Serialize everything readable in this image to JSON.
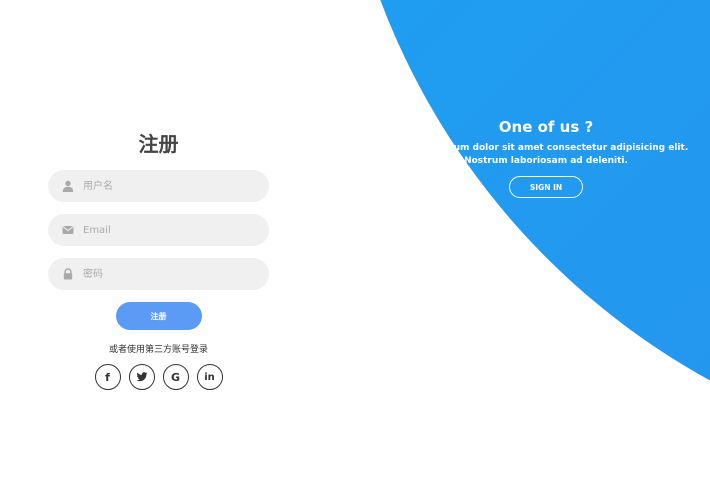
{
  "register_form": {
    "title": "注册",
    "username_placeholder": "用户名",
    "email_placeholder": "Email",
    "password_placeholder": "密码",
    "submit_label": "注册",
    "social_text": "或者使用第三方账号登录",
    "social": [
      {
        "icon": "facebook-icon",
        "glyph": "f"
      },
      {
        "icon": "twitter-icon",
        "glyph": ""
      },
      {
        "icon": "google-icon",
        "glyph": "G"
      },
      {
        "icon": "linkedin-icon",
        "glyph": "in"
      }
    ]
  },
  "panel": {
    "title": "One of us ?",
    "text_line1": "Lorem ipsum dolor sit amet consectetur adipisicing elit.",
    "text_line2": "Nostrum laboriosam ad deleniti.",
    "button_label": "SIGN IN"
  },
  "colors": {
    "panel_gradient_start": "#18a6f5",
    "panel_gradient_end": "#2b8de9",
    "primary_button": "#5b9bf5",
    "field_background": "#f0f0f0",
    "icon_gray": "#a9a9a9"
  }
}
